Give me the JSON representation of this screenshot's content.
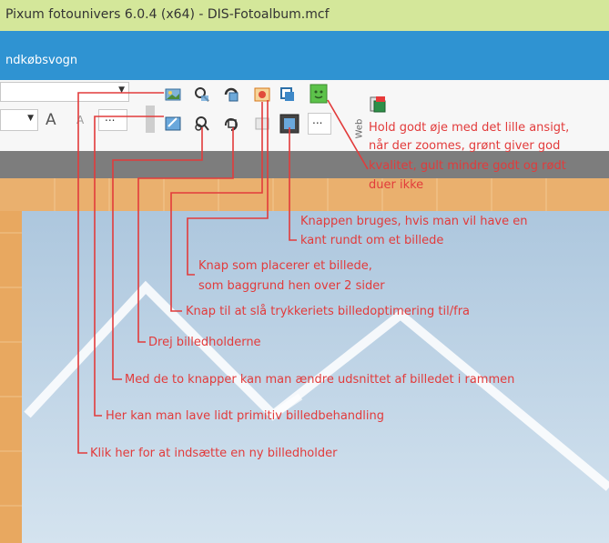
{
  "window": {
    "title": "Pixum fotounivers 6.0.4 (x64) - DIS-Fotoalbum.mcf"
  },
  "menu": {
    "item": "ndkøbsvogn"
  },
  "ribbon": {
    "font_grow": "A",
    "font_shrink": "A",
    "more_label": "...",
    "vertical_label": "Web"
  },
  "annotations": [
    "Hold godt øje med det lille ansigt,",
    "når der zoomes, grønt giver god",
    "kvalitet, gult mindre godt og rødt",
    "duer ikke",
    "Knappen bruges, hvis man vil have en",
    "kant rundt om et billede",
    "Knap som placerer et billede,",
    "som baggrund hen over 2 sider",
    "Knap til at slå trykkeriets billedoptimering til/fra",
    "Drej billedholderne",
    "Med de to knapper kan man ændre udsnittet af billedet i rammen",
    "Her kan man lave lidt primitiv billedbehandling",
    "Klik her for at indsætte en ny billedholder"
  ],
  "colors": {
    "annotation": "#e23b3b",
    "titlebar": "#d4e79a",
    "menubar": "#2f93d2",
    "canvas": "#c9d9e6",
    "border_tiles": "#e8a860"
  },
  "icons": [
    "insert-picture-holder-icon",
    "zoom-in-icon",
    "rotate-icon",
    "background-picture-icon",
    "frame-icon",
    "quality-face-icon",
    "image-edit-icon",
    "zoom-out-icon",
    "rotate-holder-icon",
    "optimization-icon",
    "border-icon",
    "ellipsis-icon"
  ]
}
